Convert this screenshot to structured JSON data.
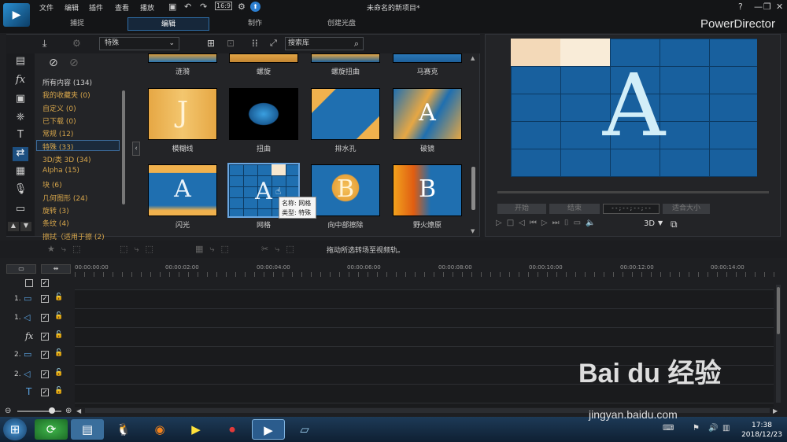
{
  "menu": {
    "file": "文件",
    "edit": "编辑",
    "plugin": "插件",
    "view": "查看",
    "play": "播放"
  },
  "window": {
    "project_title": "未命名的新项目*",
    "brand": "PowerDirector",
    "help": "?",
    "minimize": "—",
    "restore": "❐",
    "close": "✕"
  },
  "tabs": {
    "capture": "捕捉",
    "edit": "编辑",
    "produce": "制作",
    "disc": "创建光盘"
  },
  "library": {
    "dropdown": "特殊",
    "search_placeholder": "搜索库"
  },
  "categories": [
    {
      "label": "所有内容 (134)",
      "color": "white"
    },
    {
      "label": "我的收藏夹 (0)",
      "color": "orange"
    },
    {
      "label": "自定义 (0)",
      "color": "orange"
    },
    {
      "label": "已下载 (0)",
      "color": "orange"
    },
    {
      "label": "常规 (12)",
      "color": "orange"
    },
    {
      "label": "特殊 (33)",
      "color": "orange"
    },
    {
      "label": "3D/类 3D (34)",
      "color": "orange"
    },
    {
      "label": "Alpha (15)",
      "color": "orange"
    },
    {
      "label": "块 (6)",
      "color": "orange"
    },
    {
      "label": "几何图形 (24)",
      "color": "orange"
    },
    {
      "label": "旋转 (3)",
      "color": "orange"
    },
    {
      "label": "条纹 (4)",
      "color": "orange"
    },
    {
      "label": "擦拭（适用于擦 (2)",
      "color": "orange"
    }
  ],
  "transitions_row1": [
    "涟漪",
    "螺旋",
    "螺旋扭曲",
    "马赛克"
  ],
  "transitions_row2": [
    "模糊线",
    "扭曲",
    "排水孔",
    "破镜"
  ],
  "transitions_row3": [
    "闪光",
    "网格",
    "向中部擦除",
    "野火燎原"
  ],
  "tooltip": {
    "name": "名称: 网格",
    "type": "类型: 特殊"
  },
  "preview": {
    "btn_start": "开始",
    "btn_end": "结束",
    "timecode": "- - ; - - ; - - ; - -",
    "zoom": "适合大小",
    "mode": "3D"
  },
  "timeline": {
    "hint": "拖动所选转场至视频轨。",
    "ticks": [
      "00:00:00:00",
      "00:00:02:00",
      "00:00:04:00",
      "00:00:06:00",
      "00:00:08:00",
      "00:00:10:00",
      "00:00:12:00",
      "00:00:14:00"
    ],
    "tracks": [
      {
        "num": "1.",
        "icon": "video"
      },
      {
        "num": "1.",
        "icon": "audio"
      },
      {
        "num": "",
        "icon": "fx"
      },
      {
        "num": "2.",
        "icon": "video"
      },
      {
        "num": "2.",
        "icon": "audio"
      },
      {
        "num": "",
        "icon": "title"
      }
    ]
  },
  "taskbar": {
    "time": "17:38",
    "date": "2018/12/23"
  },
  "watermark": {
    "brand": "Bai du 经验",
    "url": "jingyan.baidu.com"
  }
}
